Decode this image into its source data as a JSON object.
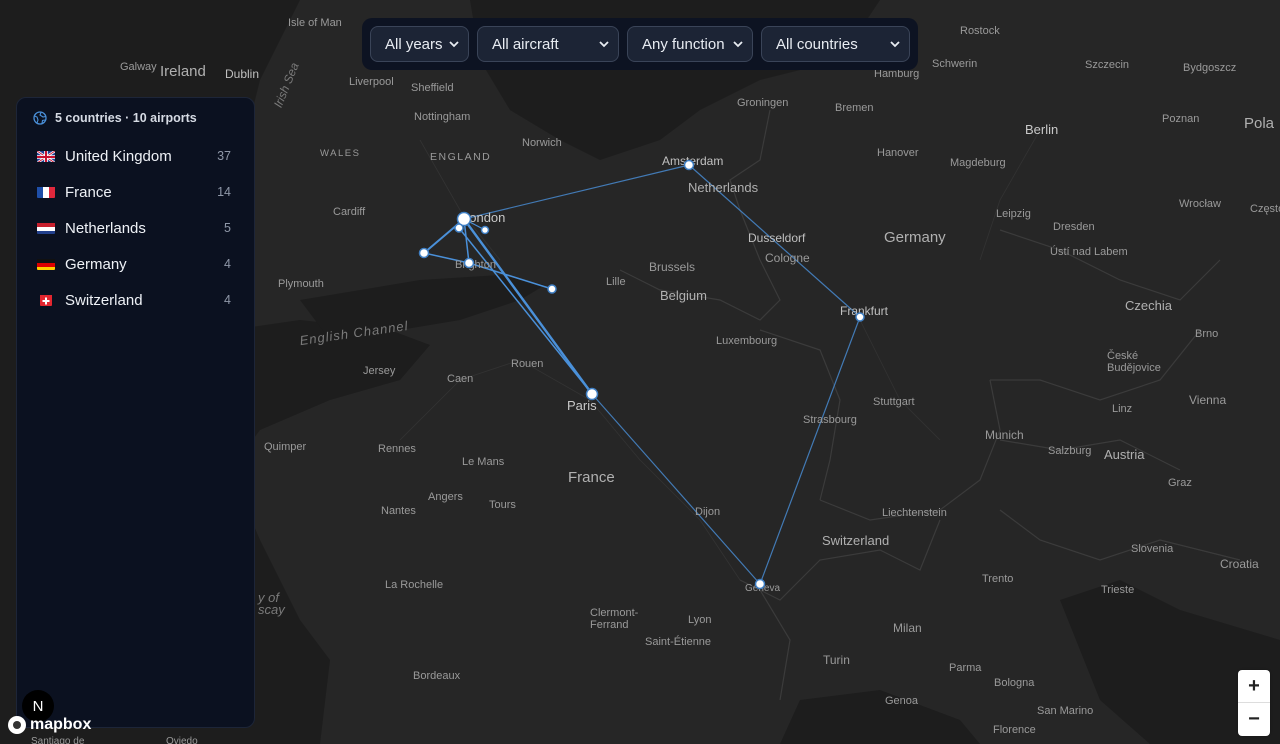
{
  "filters": {
    "years": "All years",
    "aircraft": "All aircraft",
    "function": "Any function",
    "countries": "All countries"
  },
  "summary": "5 countries · 10 airports",
  "countries": [
    {
      "name": "United Kingdom",
      "count": "37",
      "flag": "uk-flag-icon"
    },
    {
      "name": "France",
      "count": "14",
      "flag": "france-flag-icon"
    },
    {
      "name": "Netherlands",
      "count": "5",
      "flag": "netherlands-flag-icon"
    },
    {
      "name": "Germany",
      "count": "4",
      "flag": "germany-flag-icon"
    },
    {
      "name": "Switzerland",
      "count": "4",
      "flag": "switzerland-flag-icon"
    }
  ],
  "map": {
    "labels": {
      "isle_of_man": "Isle of Man",
      "ireland": "Ireland",
      "dublin": "Dublin",
      "galway": "Galway",
      "irish_sea": "Irish Sea",
      "liverpool": "Liverpool",
      "sheffield": "Sheffield",
      "nottingham": "Nottingham",
      "norwich": "Norwich",
      "wales": "WALES",
      "england": "ENGLAND",
      "cardiff": "Cardiff",
      "plymouth": "Plymouth",
      "london": "London",
      "brighton": "Brighton",
      "english_channel": "English Channel",
      "jersey": "Jersey",
      "caen": "Caen",
      "rouen": "Rouen",
      "paris": "Paris",
      "quimper": "Quimper",
      "rennes": "Rennes",
      "le_mans": "Le Mans",
      "france": "France",
      "angers": "Angers",
      "nantes": "Nantes",
      "tours": "Tours",
      "dijon": "Dijon",
      "la_rochelle": "La Rochelle",
      "clermont": "Clermont-\nFerrand",
      "lyon": "Lyon",
      "saint_etienne": "Saint-Étienne",
      "bordeaux": "Bordeaux",
      "biscay": "y of\nscay",
      "lille": "Lille",
      "brussels": "Brussels",
      "belgium": "Belgium",
      "luxembourg": "Luxembourg",
      "amsterdam": "Amsterdam",
      "netherlands": "Netherlands",
      "groningen": "Groningen",
      "bremen": "Bremen",
      "hamburg": "Hamburg",
      "schwerin": "Schwerin",
      "rostock": "Rostock",
      "szczecin": "Szczecin",
      "bydgoszcz": "Bydgoszcz",
      "poznan": "Poznan",
      "pola": "Pola",
      "berlin": "Berlin",
      "hanover": "Hanover",
      "magdeburg": "Magdeburg",
      "leipzig": "Leipzig",
      "dresden": "Dresden",
      "wroclaw": "Wrocław",
      "czesto": "Często",
      "usti": "Ústí nad Labem",
      "germany": "Germany",
      "dusseldorf": "Dusseldorf",
      "cologne": "Cologne",
      "frankfurt": "Frankfurt",
      "czechia": "Czechia",
      "brno": "Brno",
      "ceske": "České\nBudějovice",
      "linz": "Linz",
      "vienna": "Vienna",
      "stuttgart": "Stuttgart",
      "strasbourg": "Strasbourg",
      "munich": "Munich",
      "salzburg": "Salzburg",
      "austria": "Austria",
      "graz": "Graz",
      "liechtenstein": "Liechtenstein",
      "switzerland": "Switzerland",
      "geneva": "Geneva",
      "slovenia": "Slovenia",
      "croatia": "Croatia",
      "trento": "Trento",
      "trieste": "Trieste",
      "milan": "Milan",
      "turin": "Turin",
      "parma": "Parma",
      "bologna": "Bologna",
      "genoa": "Genoa",
      "san_marino": "San Marino",
      "florence": "Florence",
      "santiago": "Santiago de",
      "oviedo": "Oviedo"
    }
  },
  "zoom": {
    "in": "+",
    "out": "−"
  },
  "attribution": {
    "logo_text": "mapbox",
    "n_button": "N"
  },
  "colors": {
    "route": "#4a90d9",
    "airport_fill": "#ffffff",
    "airport_stroke": "#3f7fc4",
    "land": "#262626",
    "sea": "#1f1f1f",
    "panel_bg": "#0b1120"
  }
}
